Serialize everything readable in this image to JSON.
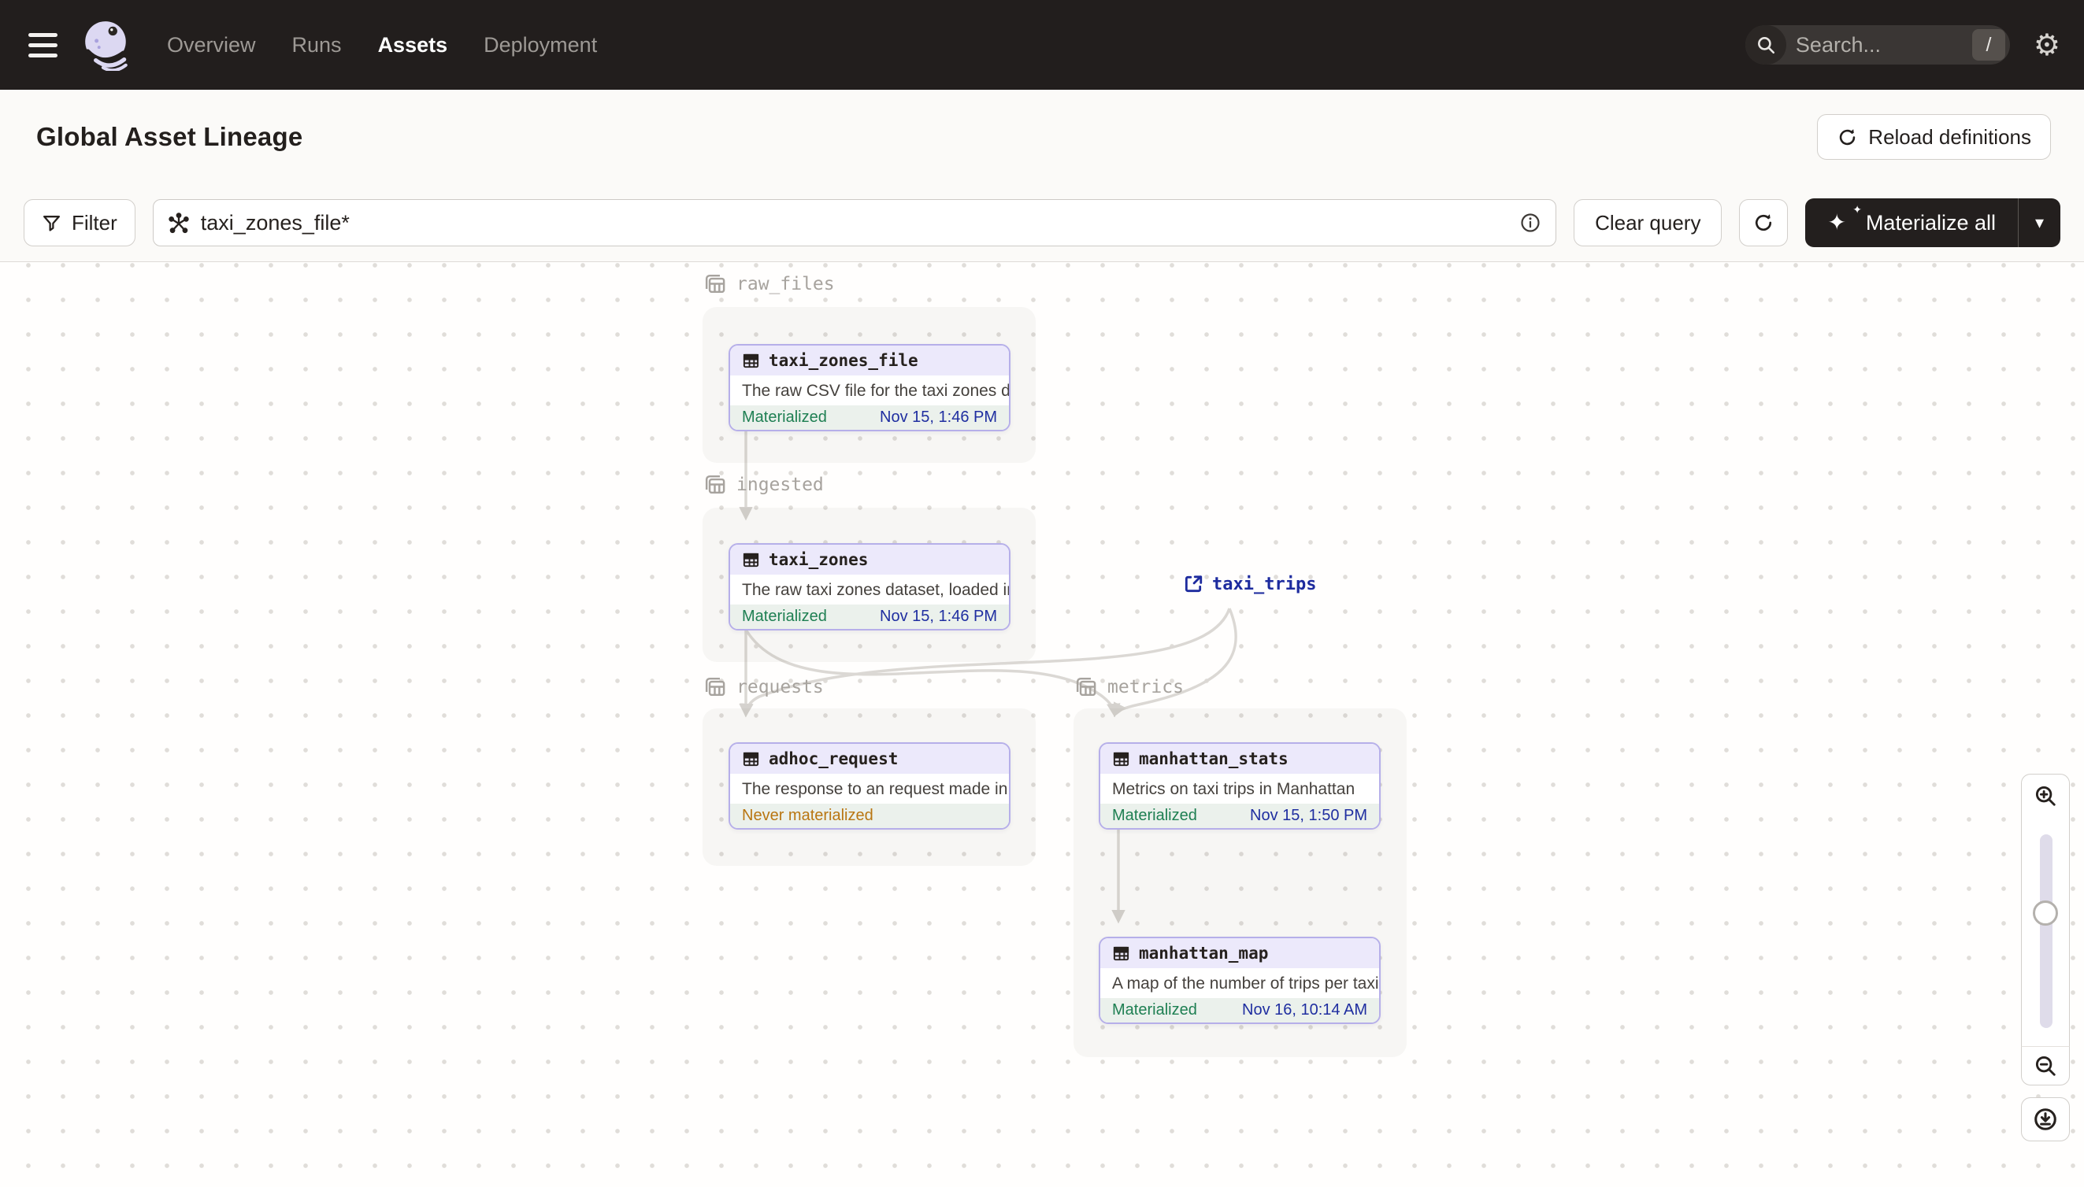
{
  "navbar": {
    "items": [
      {
        "label": "Overview",
        "active": false
      },
      {
        "label": "Runs",
        "active": false
      },
      {
        "label": "Assets",
        "active": true
      },
      {
        "label": "Deployment",
        "active": false
      }
    ],
    "search": {
      "placeholder": "Search...",
      "shortcut": "/"
    }
  },
  "header": {
    "title": "Global Asset Lineage",
    "reload_label": "Reload definitions"
  },
  "toolbar": {
    "filter_label": "Filter",
    "query_value": "taxi_zones_file*",
    "clear_label": "Clear query",
    "materialize_label": "Materialize all"
  },
  "graph": {
    "groups": [
      {
        "name": "raw_files"
      },
      {
        "name": "ingested"
      },
      {
        "name": "requests"
      },
      {
        "name": "metrics"
      }
    ],
    "nodes": [
      {
        "name": "taxi_zones_file",
        "description": "The raw CSV file for the taxi zones dat...",
        "status": "Materialized",
        "timestamp": "Nov 15, 1:46 PM",
        "group": "raw_files"
      },
      {
        "name": "taxi_zones",
        "description": "The raw taxi zones dataset, loaded int...",
        "status": "Materialized",
        "timestamp": "Nov 15, 1:46 PM",
        "group": "ingested"
      },
      {
        "name": "adhoc_request",
        "description": "The response to an request made in th...",
        "status": "Never materialized",
        "timestamp": "",
        "group": "requests"
      },
      {
        "name": "manhattan_stats",
        "description": "Metrics on taxi trips in Manhattan",
        "status": "Materialized",
        "timestamp": "Nov 15, 1:50 PM",
        "group": "metrics"
      },
      {
        "name": "manhattan_map",
        "description": "A map of the number of trips per taxi z...",
        "status": "Materialized",
        "timestamp": "Nov 16, 10:14 AM",
        "group": "metrics"
      }
    ],
    "external_asset": {
      "name": "taxi_trips"
    },
    "edges": [
      "taxi_zones_file->taxi_zones",
      "taxi_zones->adhoc_request",
      "taxi_zones->manhattan_stats",
      "taxi_trips->adhoc_request",
      "taxi_trips->manhattan_stats",
      "manhattan_stats->manhattan_map"
    ]
  },
  "icons": {
    "gear": "⚙",
    "caret": "▾",
    "sparkle": "✦",
    "sparkle_small": "✦"
  },
  "colors": {
    "navbar_bg": "#221E1D",
    "accent_purple_border": "#B6AFE9",
    "node_header_bg": "#ECE9FB",
    "node_footer_bg": "#EBF1EC",
    "status_materialized": "#1E7F52",
    "status_never": "#B97612",
    "timestamp_navy": "#1F2EA0",
    "external_link_navy": "#1D2B9E",
    "edge_gray": "#DBD8D4"
  }
}
